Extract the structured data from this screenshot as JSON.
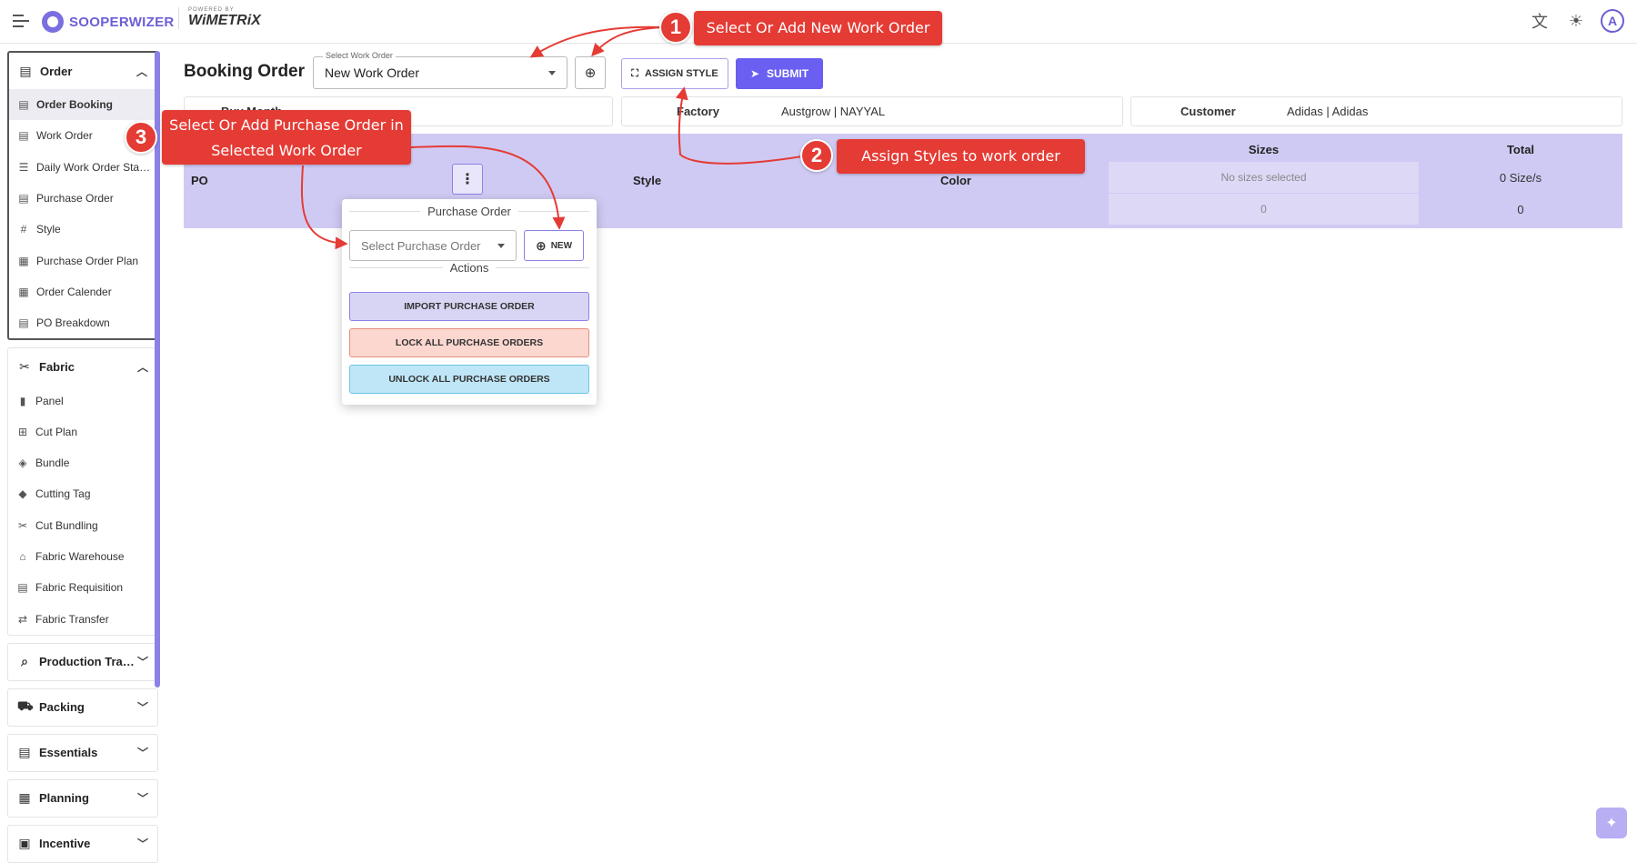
{
  "header": {
    "brand": "SOOPERWIZER",
    "powered_by": "POWERED BY",
    "partner": "WiMETRiX",
    "avatar_initial": "A"
  },
  "sidebar": {
    "groups": [
      {
        "label": "Order",
        "icon": "order-icon",
        "expanded": true,
        "items": [
          {
            "label": "Order Booking",
            "active": true
          },
          {
            "label": "Work Order"
          },
          {
            "label": "Daily Work Order Stat..."
          },
          {
            "label": "Purchase Order"
          },
          {
            "label": "Style"
          },
          {
            "label": "Purchase Order Plan"
          },
          {
            "label": "Order Calender"
          },
          {
            "label": "PO Breakdown"
          }
        ]
      },
      {
        "label": "Fabric",
        "icon": "scissors-icon",
        "expanded": true,
        "items": [
          {
            "label": "Panel"
          },
          {
            "label": "Cut Plan"
          },
          {
            "label": "Bundle"
          },
          {
            "label": "Cutting Tag"
          },
          {
            "label": "Cut Bundling"
          },
          {
            "label": "Fabric Warehouse"
          },
          {
            "label": "Fabric Requisition"
          },
          {
            "label": "Fabric Transfer"
          }
        ]
      },
      {
        "label": "Production Track...",
        "icon": "tracking-icon",
        "expanded": false
      },
      {
        "label": "Packing",
        "icon": "truck-icon",
        "expanded": false
      },
      {
        "label": "Essentials",
        "icon": "essentials-icon",
        "expanded": false
      },
      {
        "label": "Planning",
        "icon": "calendar-icon",
        "expanded": false
      },
      {
        "label": "Incentive",
        "icon": "incentive-icon",
        "expanded": false
      }
    ]
  },
  "main": {
    "title": "Booking Order",
    "work_order_label": "Select Work Order",
    "work_order_value": "New Work Order",
    "assign_style": "ASSIGN STYLE",
    "submit": "SUBMIT",
    "info": {
      "first_label": "Buy Month",
      "factory_label": "Factory",
      "factory_value": "Austgrow | NAYYAL",
      "customer_label": "Customer",
      "customer_value": "Adidas | Adidas"
    },
    "grid": {
      "po": "PO",
      "style": "Style",
      "color": "Color",
      "sizes": "Sizes",
      "no_sizes": "No sizes selected",
      "sizes_zero": "0",
      "total": "Total",
      "total_sizes": "0 Size/s",
      "total_zero": "0"
    },
    "popup": {
      "section_po": "Purchase Order",
      "select_placeholder": "Select Purchase Order",
      "new": "NEW",
      "section_actions": "Actions",
      "import": "IMPORT PURCHASE ORDER",
      "lock": "LOCK ALL PURCHASE ORDERS",
      "unlock": "UNLOCK ALL PURCHASE ORDERS"
    }
  },
  "annotations": [
    {
      "number": "1",
      "text": "Select Or Add New Work Order"
    },
    {
      "number": "2",
      "text": "Assign Styles to work order"
    },
    {
      "number": "3",
      "text_line1": "Select Or Add Purchase Order in",
      "text_line2": "Selected Work Order"
    }
  ],
  "colors": {
    "accent": "#6a5ff0",
    "grid_header": "#cfcaf3",
    "callout": "#e53b35"
  }
}
